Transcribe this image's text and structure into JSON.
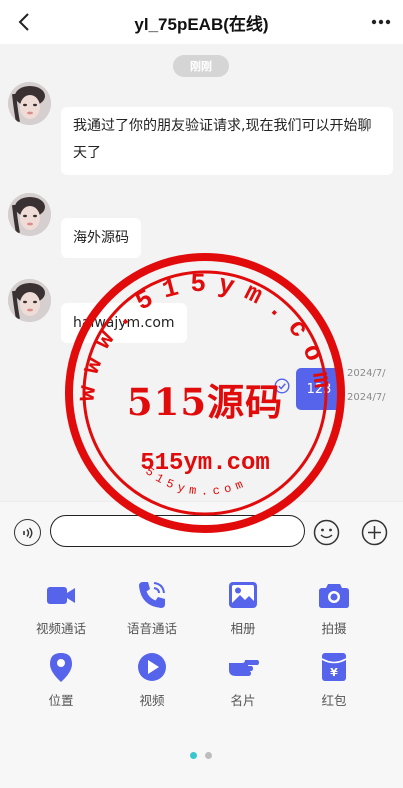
{
  "header": {
    "title": "yl_75pEAB(在线)"
  },
  "chat": {
    "time_divider": "刚刚",
    "messages": [
      {
        "text_line1": "我通过了你的朋友验证请求,现在我们可以开始聊",
        "text_line2": "天了"
      },
      {
        "text": "海外源码"
      },
      {
        "text": "haiwajym.com"
      }
    ],
    "sent": {
      "text": "123",
      "time1": "2024/7/",
      "time2": "2024/7/"
    }
  },
  "input": {
    "placeholder": ""
  },
  "panel": {
    "tools": [
      {
        "label": "视频通话",
        "icon": "video-camera-icon"
      },
      {
        "label": "语音通话",
        "icon": "phone-icon"
      },
      {
        "label": "相册",
        "icon": "picture-icon"
      },
      {
        "label": "拍摄",
        "icon": "camera-icon"
      },
      {
        "label": "位置",
        "icon": "location-pin-icon"
      },
      {
        "label": "视频",
        "icon": "play-icon"
      },
      {
        "label": "名片",
        "icon": "pointing-hand-icon"
      },
      {
        "label": "红包",
        "icon": "red-packet-icon"
      }
    ],
    "page_dots": {
      "count": 2,
      "active": 0
    }
  },
  "watermark": {
    "ring_text": "www.515ym.com",
    "center_cn": "515源码",
    "center_en": "515ym.com",
    "bottom_text": "515ym.com",
    "color": "#e10b0b"
  },
  "colors": {
    "accent": "#5564ea",
    "dot_active": "#38c6cf",
    "dot_inactive": "#bdbdbd"
  }
}
